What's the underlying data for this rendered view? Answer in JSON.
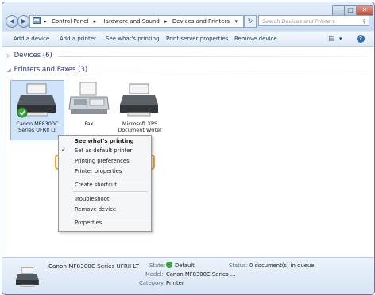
{
  "window": {
    "minimize_glyph": "–",
    "maximize_glyph": "□",
    "close_glyph": "✕",
    "back_glyph": "◀",
    "forward_glyph": "▶",
    "refresh_glyph": "↻"
  },
  "address": {
    "crumbs": [
      "Control Panel",
      "Hardware and Sound",
      "Devices and Printers"
    ],
    "separator": "▸",
    "dropdown_glyph": "▾"
  },
  "search": {
    "placeholder": "Search Devices and Printers",
    "icon": "⚲"
  },
  "toolbar": {
    "add_device": "Add a device",
    "add_printer": "Add a printer",
    "see_printing": "See what's printing",
    "server_props": "Print server properties",
    "remove_device": "Remove device",
    "view_glyph": "▤",
    "view_dropdown_glyph": "▾",
    "help_glyph": "?"
  },
  "groups": {
    "devices": "Devices (6)",
    "printers": "Printers and Faxes (3)",
    "collapsed_arrow": "▷",
    "expanded_arrow": "◢"
  },
  "printers": [
    {
      "line1": "Canon MF8300C",
      "line2": "Series UFRII LT"
    },
    {
      "line1": "Fax",
      "line2": ""
    },
    {
      "line1": "Microsoft XPS",
      "line2": "Document Writer"
    }
  ],
  "context_menu": {
    "see_printing": "See what's printing",
    "set_default": "Set as default printer",
    "printing_prefs": "Printing preferences",
    "printer_props": "Printer properties",
    "create_shortcut": "Create shortcut",
    "troubleshoot": "Troubleshoot",
    "remove_device": "Remove device",
    "properties": "Properties",
    "check_glyph": "✓"
  },
  "details": {
    "name": "Canon MF8300C Series UFRII LT",
    "state_label": "State:",
    "state_value": "Default",
    "status_label": "Status:",
    "status_value": "0 document(s) in queue",
    "model_label": "Model:",
    "model_value": "Canon MF8300C Series ...",
    "category_label": "Category:",
    "category_value": "Printer"
  },
  "colors": {
    "accent": "#f0a22a",
    "link": "#1e3287",
    "default_badge": "#3aa83a"
  }
}
